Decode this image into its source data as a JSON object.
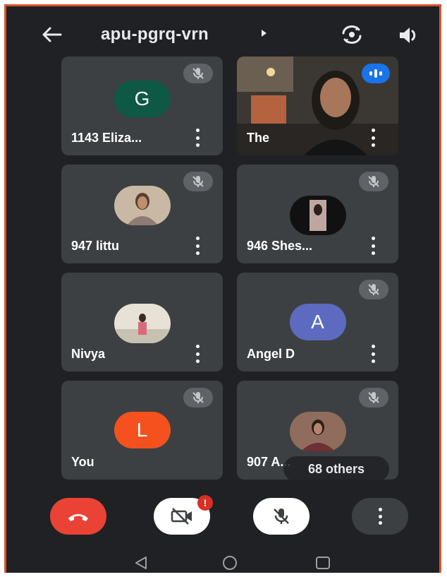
{
  "meeting": {
    "title": "apu-pgrq-vrn"
  },
  "icons": {
    "back": "arrow-back-icon",
    "flip_camera": "flip-camera-icon",
    "speaker": "speaker-icon",
    "muted": "mic-off-icon",
    "more": "more-vert-icon",
    "end_call": "call-end-icon",
    "camera_off": "videocam-off-icon",
    "mic_off": "mic-off-icon",
    "nav_back": "nav-back-icon",
    "nav_home": "nav-home-icon",
    "nav_recents": "nav-recents-icon"
  },
  "participants": [
    {
      "name": "1143 Eliza...",
      "avatar_letter": "G",
      "avatar_color": "#0d5945",
      "muted": true
    },
    {
      "name": "The",
      "video": true,
      "speaking": true
    },
    {
      "name": "947 littu",
      "photo": true,
      "muted": true
    },
    {
      "name": "946 Shes...",
      "photo": true,
      "muted": true
    },
    {
      "name": "Nivya",
      "photo": true,
      "muted": false
    },
    {
      "name": "Angel D",
      "avatar_letter": "A",
      "avatar_color": "#5c6bc0",
      "muted": true
    },
    {
      "name": "You",
      "avatar_letter": "L",
      "avatar_color": "#f4511e",
      "muted": true
    },
    {
      "name": "907 A...",
      "photo": true,
      "muted": true
    }
  ],
  "others_label": "68 others",
  "controls": {
    "camera_alert": "!"
  },
  "colors": {
    "background": "#202124",
    "tile": "#3c4043",
    "end_call": "#ea4335",
    "speaking": "#1a73e8",
    "frame_border": "#d8552d"
  }
}
